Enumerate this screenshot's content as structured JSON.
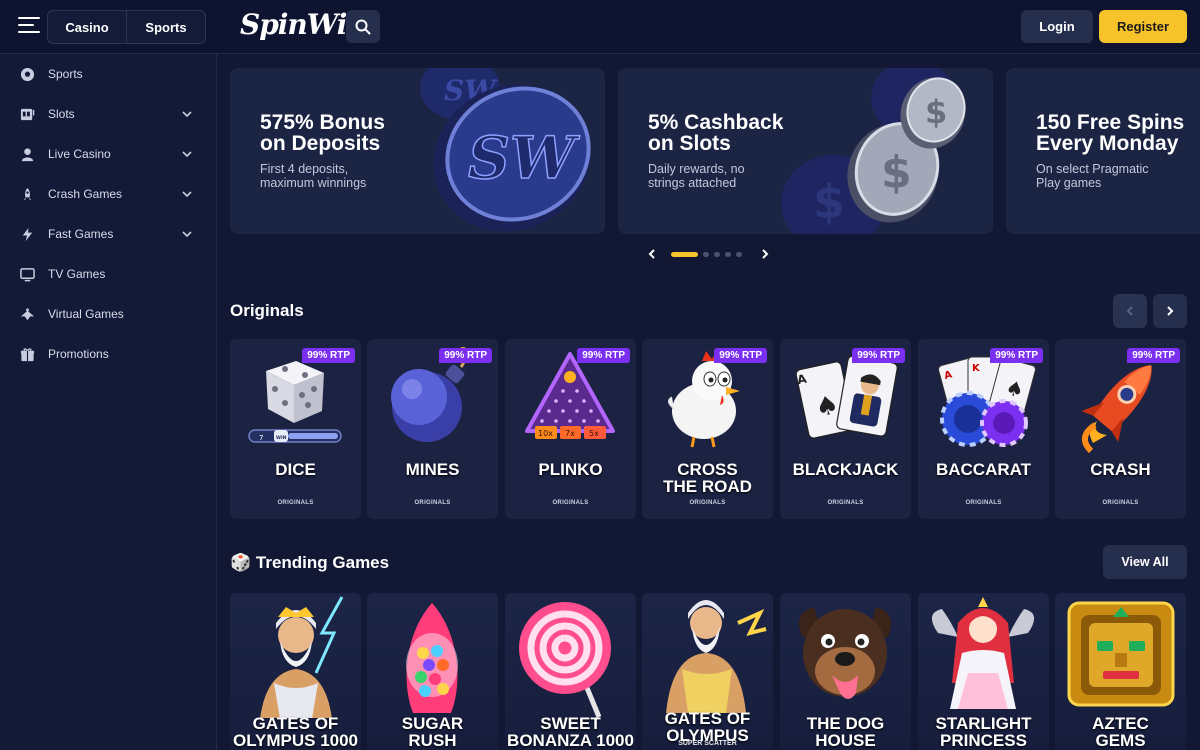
{
  "header": {
    "modes": [
      "Casino",
      "Sports"
    ],
    "logo_text": "SpinWin",
    "login_label": "Login",
    "register_label": "Register",
    "accent_color": "#f7c32b"
  },
  "sidebar": {
    "items": [
      {
        "label": "Sports",
        "icon": "soccer-ball-icon",
        "has_submenu": false
      },
      {
        "label": "Slots",
        "icon": "slot-machine-icon",
        "has_submenu": true
      },
      {
        "label": "Live Casino",
        "icon": "dealer-icon",
        "has_submenu": true
      },
      {
        "label": "Crash Games",
        "icon": "rocket-icon",
        "has_submenu": true
      },
      {
        "label": "Fast Games",
        "icon": "lightning-icon",
        "has_submenu": true
      },
      {
        "label": "TV Games",
        "icon": "tv-icon",
        "has_submenu": false
      },
      {
        "label": "Virtual Games",
        "icon": "virtual-icon",
        "has_submenu": false
      },
      {
        "label": "Promotions",
        "icon": "gift-icon",
        "has_submenu": false
      }
    ]
  },
  "banners": [
    {
      "title": "575% Bonus\non Deposits",
      "subtitle": "First 4 deposits,\nmaximum winnings"
    },
    {
      "title": "5% Cashback\non Slots",
      "subtitle": "Daily rewards, no\nstrings attached"
    },
    {
      "title": "150 Free Spins\nEvery Monday",
      "subtitle": "On select Pragmatic\nPlay games"
    }
  ],
  "carousel": {
    "active_index": 0,
    "dot_count": 5
  },
  "originals": {
    "title": "Originals",
    "games": [
      {
        "name": "DICE",
        "rtp": "99% RTP",
        "tag": "ORIGINALS"
      },
      {
        "name": "MINES",
        "rtp": "99% RTP",
        "tag": "ORIGINALS"
      },
      {
        "name": "PLINKO",
        "rtp": "99% RTP",
        "tag": "ORIGINALS"
      },
      {
        "name": "CROSS\nTHE ROAD",
        "rtp": "99% RTP",
        "tag": "ORIGINALS"
      },
      {
        "name": "BLACKJACK",
        "rtp": "99% RTP",
        "tag": "ORIGINALS"
      },
      {
        "name": "BACCARAT",
        "rtp": "99% RTP",
        "tag": "ORIGINALS"
      },
      {
        "name": "CRASH",
        "rtp": "99% RTP",
        "tag": "ORIGINALS"
      }
    ],
    "dice_widget": {
      "left": "7",
      "right": "WIN"
    },
    "plinko_multipliers": [
      "10x",
      "7x",
      "5x"
    ]
  },
  "trending": {
    "title": "🎲 Trending Games",
    "view_all_label": "View All",
    "games": [
      {
        "name": "GATES OF\nOLYMPUS 1000",
        "subtitle": ""
      },
      {
        "name": "SUGAR\nRUSH",
        "subtitle": ""
      },
      {
        "name": "SWEET\nBONANZA 1000",
        "subtitle": ""
      },
      {
        "name": "GATES OF\nOLYMPUS",
        "subtitle": "SUPER SCATTER"
      },
      {
        "name": "THE DOG HOUSE\nMEGAWAYS",
        "subtitle": ""
      },
      {
        "name": "STARLIGHT\nPRINCESS",
        "subtitle": ""
      },
      {
        "name": "AZTEC\nGEMS",
        "subtitle": ""
      }
    ]
  }
}
